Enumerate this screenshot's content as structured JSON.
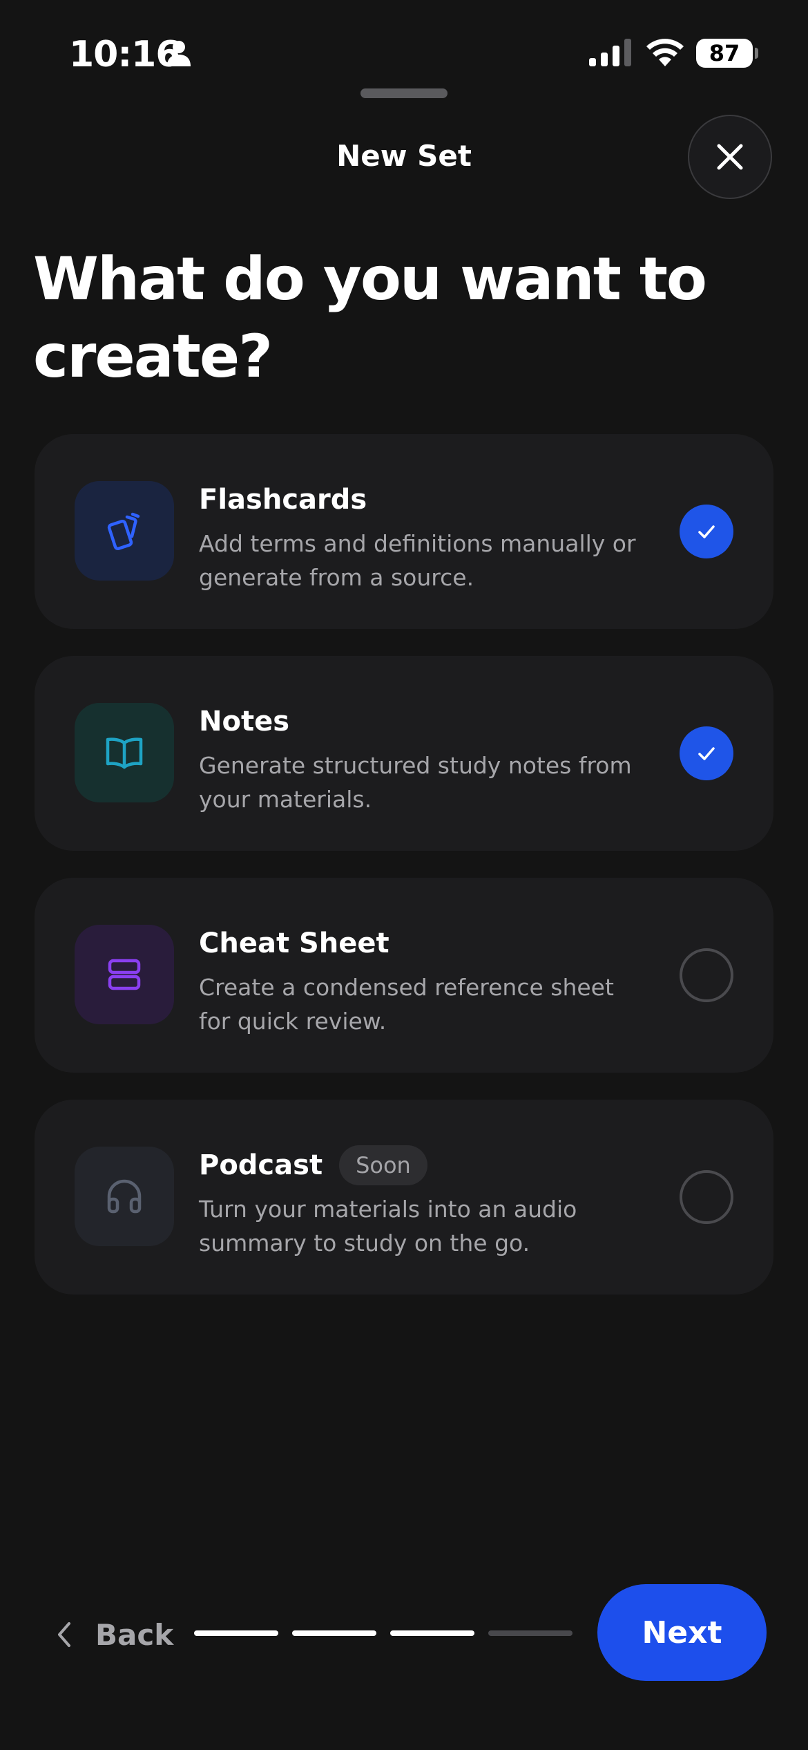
{
  "status_bar": {
    "time": "10:16",
    "battery": "87",
    "icons": [
      "person-icon",
      "signal-icon",
      "wifi-icon",
      "battery-icon"
    ]
  },
  "sheet": {
    "title": "New Set",
    "close_icon": "close-icon"
  },
  "headline": "What do you want to create?",
  "options": [
    {
      "title": "Flashcards",
      "description": "Add terms and definitions manually or generate from a source.",
      "icon": "flashcards-icon",
      "icon_color": "#2f62ff",
      "icon_bg": "#1a2440",
      "selected": true
    },
    {
      "title": "Notes",
      "description": "Generate structured study notes from your materials.",
      "icon": "book-icon",
      "icon_color": "#1ea3c4",
      "icon_bg": "#16302f",
      "selected": true
    },
    {
      "title": "Cheat Sheet",
      "description": "Create a condensed reference sheet for quick review.",
      "icon": "cheat-sheet-icon",
      "icon_color": "#8a3ff0",
      "icon_bg": "#291c3b",
      "selected": false
    },
    {
      "title": "Podcast",
      "badge": "Soon",
      "description": "Turn your materials into an audio summary to study on the go.",
      "icon": "headphones-icon",
      "icon_color": "#5a6170",
      "icon_bg": "#23252b",
      "selected": false
    }
  ],
  "footer": {
    "back_label": "Back",
    "next_label": "Next",
    "progress_step": 3,
    "progress_total": 4
  },
  "colors": {
    "background": "#141414",
    "card": "#1c1c1e",
    "accent": "#1d4fec"
  }
}
